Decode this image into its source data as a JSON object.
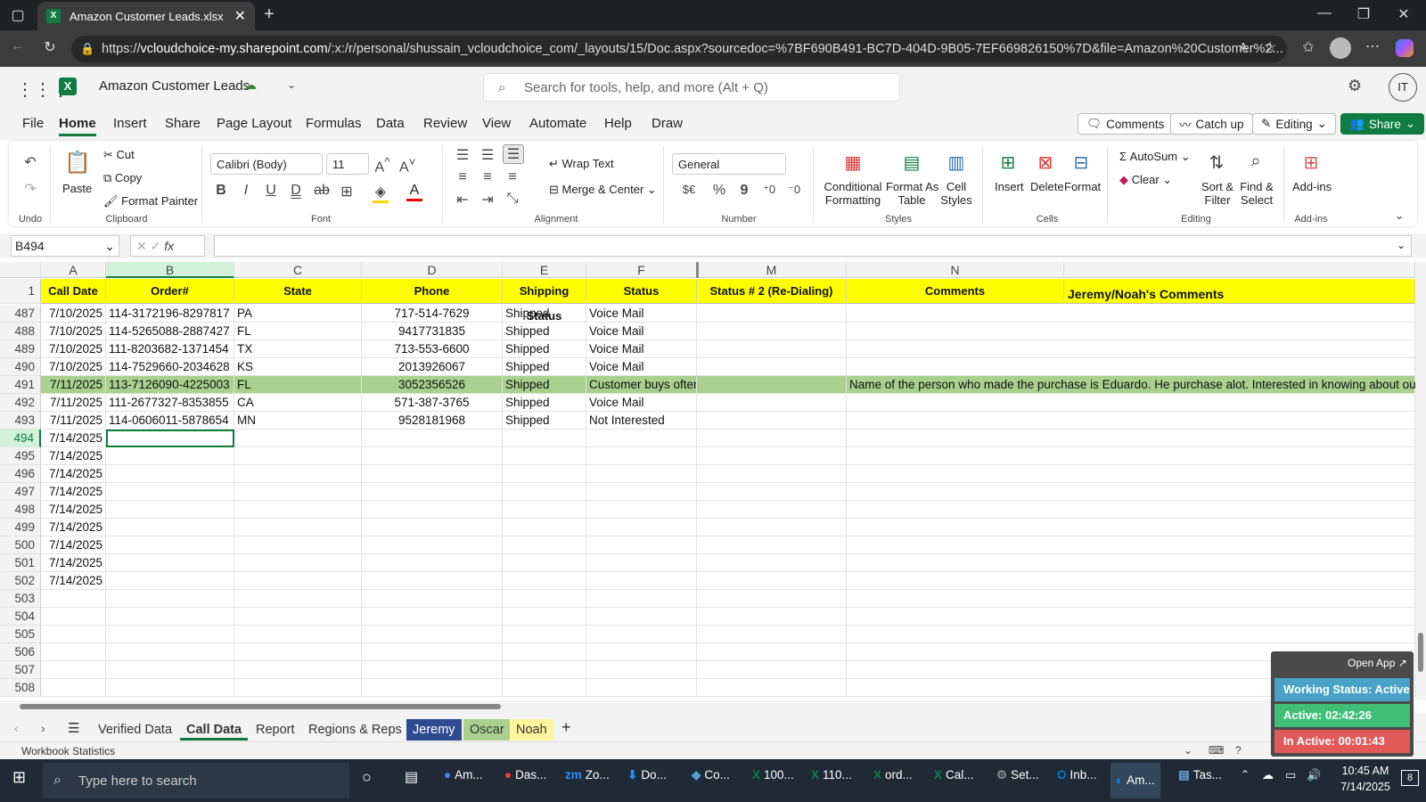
{
  "browser": {
    "tab_title": "Amazon Customer Leads.xlsx",
    "url_prefix": "https://",
    "url_domain": "vcloudchoice-my.sharepoint.com",
    "url_rest": "/:x:/r/personal/shussain_vcloudchoice_com/_layouts/15/Doc.aspx?sourcedoc=%7BF690B491-BC7D-404D-9B05-7EF669826150%7D&file=Amazon%20Customer%2..."
  },
  "app": {
    "doc_title": "Amazon Customer Leads",
    "search_placeholder": "Search for tools, help, and more (Alt + Q)",
    "avatar": "IT"
  },
  "menu": {
    "items": [
      "File",
      "Home",
      "Insert",
      "Share",
      "Page Layout",
      "Formulas",
      "Data",
      "Review",
      "View",
      "Automate",
      "Help",
      "Draw"
    ],
    "comments": "Comments",
    "catchup": "Catch up",
    "editing": "Editing",
    "share": "Share"
  },
  "ribbon": {
    "undo": "Undo",
    "paste": "Paste",
    "cut": "Cut",
    "copy": "Copy",
    "format_painter": "Format Painter",
    "clipboard": "Clipboard",
    "font_name": "Calibri (Body)",
    "font_size": "11",
    "font": "Font",
    "wrap_text": "Wrap Text",
    "merge_center": "Merge & Center",
    "alignment": "Alignment",
    "number_format": "General",
    "number": "Number",
    "cond_fmt_1": "Conditional",
    "cond_fmt_2": "Formatting",
    "fmt_table_1": "Format As",
    "fmt_table_2": "Table",
    "cell_styles_1": "Cell",
    "cell_styles_2": "Styles",
    "styles": "Styles",
    "insert": "Insert",
    "delete": "Delete",
    "format": "Format",
    "cells": "Cells",
    "autosum": "AutoSum",
    "clear": "Clear",
    "sort_1": "Sort &",
    "sort_2": "Filter",
    "find_1": "Find &",
    "find_2": "Select",
    "editing": "Editing",
    "addins": "Add-ins"
  },
  "formula": {
    "name_box": "B494",
    "fx": "fx"
  },
  "grid": {
    "columns": [
      "A",
      "B",
      "C",
      "D",
      "E",
      "F",
      "M",
      "N"
    ],
    "header_row": {
      "num": "1",
      "cells": [
        "Call Date",
        "Order#",
        "State",
        "Phone",
        "Shipping Status",
        "Status",
        "Status # 2 (Re-Dialing)",
        "Comments",
        "Jeremy/Noah's Comments"
      ]
    },
    "rows": [
      {
        "num": "487",
        "date": "7/10/2025",
        "order": "114-3172196-8297817",
        "state": "PA",
        "phone": "717-514-7629",
        "ship": "Shipped",
        "status": "Voice Mail",
        "comment": ""
      },
      {
        "num": "488",
        "date": "7/10/2025",
        "order": "114-5265088-2887427",
        "state": "FL",
        "phone": "9417731835",
        "ship": "Shipped",
        "status": "Voice Mail",
        "comment": ""
      },
      {
        "num": "489",
        "date": "7/10/2025",
        "order": "111-8203682-1371454",
        "state": "TX",
        "phone": "713-553-6600",
        "ship": "Shipped",
        "status": "Voice Mail",
        "comment": ""
      },
      {
        "num": "490",
        "date": "7/10/2025",
        "order": "114-7529660-2034628",
        "state": "KS",
        "phone": "2013926067",
        "ship": "Shipped",
        "status": "Voice Mail",
        "comment": ""
      },
      {
        "num": "491",
        "date": "7/11/2025",
        "order": "113-7126090-4225003",
        "state": "FL",
        "phone": "3052356526",
        "ship": "Shipped",
        "status": "Customer buys often - Email provided",
        "comment": "Name of the person who made the purchase is Eduardo. He purchase alot. Interested in knowing about ou"
      },
      {
        "num": "492",
        "date": "7/11/2025",
        "order": "111-2677327-8353855",
        "state": "CA",
        "phone": "571-387-3765",
        "ship": "Shipped",
        "status": "Voice Mail",
        "comment": ""
      },
      {
        "num": "493",
        "date": "7/11/2025",
        "order": "114-0606011-5878654",
        "state": "MN",
        "phone": "9528181968",
        "ship": "Shipped",
        "status": "Not Interested",
        "comment": ""
      },
      {
        "num": "494",
        "date": "7/14/2025",
        "order": "",
        "state": "",
        "phone": "",
        "ship": "",
        "status": "",
        "comment": ""
      },
      {
        "num": "495",
        "date": "7/14/2025",
        "order": "",
        "state": "",
        "phone": "",
        "ship": "",
        "status": "",
        "comment": ""
      },
      {
        "num": "496",
        "date": "7/14/2025",
        "order": "",
        "state": "",
        "phone": "",
        "ship": "",
        "status": "",
        "comment": ""
      },
      {
        "num": "497",
        "date": "7/14/2025",
        "order": "",
        "state": "",
        "phone": "",
        "ship": "",
        "status": "",
        "comment": ""
      },
      {
        "num": "498",
        "date": "7/14/2025",
        "order": "",
        "state": "",
        "phone": "",
        "ship": "",
        "status": "",
        "comment": ""
      },
      {
        "num": "499",
        "date": "7/14/2025",
        "order": "",
        "state": "",
        "phone": "",
        "ship": "",
        "status": "",
        "comment": ""
      },
      {
        "num": "500",
        "date": "7/14/2025",
        "order": "",
        "state": "",
        "phone": "",
        "ship": "",
        "status": "",
        "comment": ""
      },
      {
        "num": "501",
        "date": "7/14/2025",
        "order": "",
        "state": "",
        "phone": "",
        "ship": "",
        "status": "",
        "comment": ""
      },
      {
        "num": "502",
        "date": "7/14/2025",
        "order": "",
        "state": "",
        "phone": "",
        "ship": "",
        "status": "",
        "comment": ""
      },
      {
        "num": "503",
        "date": "",
        "order": "",
        "state": "",
        "phone": "",
        "ship": "",
        "status": "",
        "comment": ""
      },
      {
        "num": "504",
        "date": "",
        "order": "",
        "state": "",
        "phone": "",
        "ship": "",
        "status": "",
        "comment": ""
      },
      {
        "num": "505",
        "date": "",
        "order": "",
        "state": "",
        "phone": "",
        "ship": "",
        "status": "",
        "comment": ""
      },
      {
        "num": "506",
        "date": "",
        "order": "",
        "state": "",
        "phone": "",
        "ship": "",
        "status": "",
        "comment": ""
      },
      {
        "num": "507",
        "date": "",
        "order": "",
        "state": "",
        "phone": "",
        "ship": "",
        "status": "",
        "comment": ""
      },
      {
        "num": "508",
        "date": "",
        "order": "",
        "state": "",
        "phone": "",
        "ship": "",
        "status": "",
        "comment": ""
      }
    ]
  },
  "sheets": [
    "Verified Data",
    "Call Data",
    "Report",
    "Regions & Reps",
    "Jeremy",
    "Oscar",
    "Noah"
  ],
  "status_bar": "Workbook Statistics",
  "widget": {
    "open_app": "Open App ↗",
    "working": "Working Status: Active",
    "active": "Active: 02:42:26",
    "inactive": "In Active: 00:01:43"
  },
  "taskbar": {
    "search": "Type here to search",
    "apps": [
      "Am...",
      "Das...",
      "Zo...",
      "Do...",
      "Co...",
      "100...",
      "110...",
      "ord...",
      "Cal...",
      "Set...",
      "Inb...",
      "Am...",
      "Tas..."
    ],
    "time": "10:45 AM",
    "date": "7/14/2025",
    "notif": "8"
  },
  "colors": {
    "header_yellow": "#ffff00",
    "highlight_green": "#a9d08e",
    "excel_green": "#107c41",
    "jeremy_tab": "#2f4b8f",
    "oscar_tab": "#a9d08e",
    "noah_tab": "#fff59d",
    "widget_blue": "#4aa3c7",
    "widget_green": "#3fbf77",
    "widget_red": "#e05a5a"
  }
}
